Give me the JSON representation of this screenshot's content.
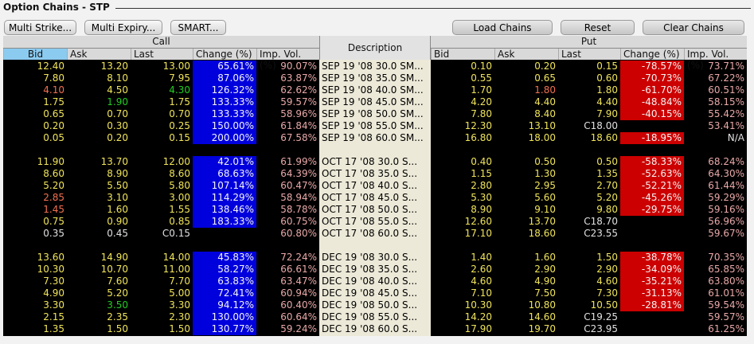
{
  "window": {
    "title": "Option Chains - STP"
  },
  "toolbar": {
    "multi_strike": "Multi Strike...",
    "multi_expiry": "Multi Expiry...",
    "smart": "SMART...",
    "load_chains": "Load Chains",
    "reset": "Reset",
    "clear_chains": "Clear Chains"
  },
  "headers": {
    "call": "Call",
    "put": "Put",
    "description": "Description",
    "bid": "Bid",
    "ask": "Ask",
    "last": "Last",
    "change": "Change (%)",
    "impvol": "Imp. Vol. (%)"
  },
  "colors": {
    "selected_header": "#8ccbf0",
    "up_bg": "#0000dd",
    "down_bg": "#cc0000"
  },
  "groups": [
    {
      "rows": [
        {
          "cb": "12.40",
          "ca": "13.20",
          "cl": "13.00",
          "cc": "65.61%",
          "civ": "90.07%",
          "d": "SEP 19 '08 30.0 SM...",
          "pb": "0.10",
          "pa": "0.20",
          "pl": "0.15",
          "pc": "-78.57%",
          "piv": "73.71%"
        },
        {
          "cb": "7.80",
          "ca": "8.10",
          "cl": "7.95",
          "cc": "87.06%",
          "civ": "63.87%",
          "d": "SEP 19 '08 35.0 SM...",
          "pb": "0.55",
          "pa": "0.65",
          "pl": "0.60",
          "pc": "-70.73%",
          "piv": "67.22%"
        },
        {
          "cb": "4.10",
          "ca": "4.50",
          "cl": "4.30",
          "cc": "126.32%",
          "civ": "62.62%",
          "d": "SEP 19 '08 40.0 SM...",
          "pb": "1.70",
          "pa": "1.80",
          "pl": "1.80",
          "pc": "-61.70%",
          "piv": "60.51%"
        },
        {
          "cb": "1.75",
          "ca": "1.90",
          "cl": "1.75",
          "cc": "133.33%",
          "civ": "59.57%",
          "d": "SEP 19 '08 45.0 SM...",
          "pb": "4.20",
          "pa": "4.40",
          "pl": "4.40",
          "pc": "-48.84%",
          "piv": "58.15%"
        },
        {
          "cb": "0.65",
          "ca": "0.70",
          "cl": "0.70",
          "cc": "133.33%",
          "civ": "58.96%",
          "d": "SEP 19 '08 50.0 SM...",
          "pb": "7.80",
          "pa": "8.40",
          "pl": "7.90",
          "pc": "-40.15%",
          "piv": "55.42%"
        },
        {
          "cb": "0.20",
          "ca": "0.30",
          "cl": "0.25",
          "cc": "150.00%",
          "civ": "61.84%",
          "d": "SEP 19 '08 55.0 SM...",
          "pb": "12.30",
          "pa": "13.10",
          "pl": "C18.00",
          "pc": "",
          "piv": "53.41%"
        },
        {
          "cb": "0.05",
          "ca": "0.20",
          "cl": "0.15",
          "cc": "200.00%",
          "civ": "67.58%",
          "d": "SEP 19 '08 60.0 SM...",
          "pb": "16.80",
          "pa": "18.00",
          "pl": "18.60",
          "pc": "-18.95%",
          "piv": "N/A"
        }
      ]
    },
    {
      "rows": [
        {
          "cb": "11.90",
          "ca": "13.70",
          "cl": "12.00",
          "cc": "42.01%",
          "civ": "61.99%",
          "d": "OCT 17 '08 30.0 S...",
          "pb": "0.40",
          "pa": "0.50",
          "pl": "0.50",
          "pc": "-58.33%",
          "piv": "68.24%"
        },
        {
          "cb": "8.60",
          "ca": "8.90",
          "cl": "8.60",
          "cc": "68.63%",
          "civ": "64.39%",
          "d": "OCT 17 '08 35.0 S...",
          "pb": "1.15",
          "pa": "1.30",
          "pl": "1.35",
          "pc": "-52.63%",
          "piv": "64.30%"
        },
        {
          "cb": "5.20",
          "ca": "5.50",
          "cl": "5.80",
          "cc": "107.14%",
          "civ": "60.47%",
          "d": "OCT 17 '08 40.0 S...",
          "pb": "2.80",
          "pa": "2.95",
          "pl": "2.70",
          "pc": "-52.21%",
          "piv": "61.44%"
        },
        {
          "cb": "2.85",
          "ca": "3.10",
          "cl": "3.00",
          "cc": "114.29%",
          "civ": "58.94%",
          "d": "OCT 17 '08 45.0 S...",
          "pb": "5.30",
          "pa": "5.60",
          "pl": "5.20",
          "pc": "-45.26%",
          "piv": "59.29%"
        },
        {
          "cb": "1.45",
          "ca": "1.60",
          "cl": "1.55",
          "cc": "138.46%",
          "civ": "58.78%",
          "d": "OCT 17 '08 50.0 S...",
          "pb": "8.90",
          "pa": "9.10",
          "pl": "9.80",
          "pc": "-29.75%",
          "piv": "59.16%"
        },
        {
          "cb": "0.75",
          "ca": "0.90",
          "cl": "0.85",
          "cc": "183.33%",
          "civ": "60.75%",
          "d": "OCT 17 '08 55.0 S...",
          "pb": "12.60",
          "pa": "13.70",
          "pl": "C18.70",
          "pc": "",
          "piv": "56.96%"
        },
        {
          "cb": "0.35",
          "ca": "0.45",
          "cl": "C0.15",
          "cc": "",
          "civ": "60.80%",
          "d": "OCT 17 '08 60.0 S...",
          "pb": "17.10",
          "pa": "18.60",
          "pl": "C23.55",
          "pc": "",
          "piv": "59.67%"
        }
      ]
    },
    {
      "rows": [
        {
          "cb": "13.60",
          "ca": "14.90",
          "cl": "14.00",
          "cc": "45.83%",
          "civ": "72.24%",
          "d": "DEC 19 '08 30.0 S...",
          "pb": "1.40",
          "pa": "1.60",
          "pl": "1.50",
          "pc": "-38.78%",
          "piv": "70.35%"
        },
        {
          "cb": "10.30",
          "ca": "10.70",
          "cl": "11.00",
          "cc": "58.27%",
          "civ": "66.61%",
          "d": "DEC 19 '08 35.0 S...",
          "pb": "2.60",
          "pa": "2.90",
          "pl": "2.90",
          "pc": "-34.09%",
          "piv": "65.85%"
        },
        {
          "cb": "7.30",
          "ca": "7.60",
          "cl": "7.70",
          "cc": "63.83%",
          "civ": "63.47%",
          "d": "DEC 19 '08 40.0 S...",
          "pb": "4.60",
          "pa": "4.90",
          "pl": "4.60",
          "pc": "-35.21%",
          "piv": "63.80%"
        },
        {
          "cb": "4.90",
          "ca": "5.20",
          "cl": "5.00",
          "cc": "72.41%",
          "civ": "60.94%",
          "d": "DEC 19 '08 45.0 S...",
          "pb": "7.10",
          "pa": "7.50",
          "pl": "7.30",
          "pc": "-31.13%",
          "piv": "61.01%"
        },
        {
          "cb": "3.30",
          "ca": "3.50",
          "cl": "3.30",
          "cc": "94.12%",
          "civ": "60.40%",
          "d": "DEC 19 '08 50.0 S...",
          "pb": "10.30",
          "pa": "10.80",
          "pl": "10.50",
          "pc": "-28.81%",
          "piv": "59.54%"
        },
        {
          "cb": "2.15",
          "ca": "2.35",
          "cl": "2.30",
          "cc": "130.00%",
          "civ": "60.64%",
          "d": "DEC 19 '08 55.0 S...",
          "pb": "14.20",
          "pa": "14.60",
          "pl": "C19.25",
          "pc": "",
          "piv": "59.57%"
        },
        {
          "cb": "1.35",
          "ca": "1.50",
          "cl": "1.50",
          "cc": "130.77%",
          "civ": "59.24%",
          "d": "DEC 19 '08 60.0 S...",
          "pb": "17.90",
          "pa": "19.70",
          "pl": "C23.95",
          "pc": "",
          "piv": "61.25%"
        }
      ]
    }
  ]
}
